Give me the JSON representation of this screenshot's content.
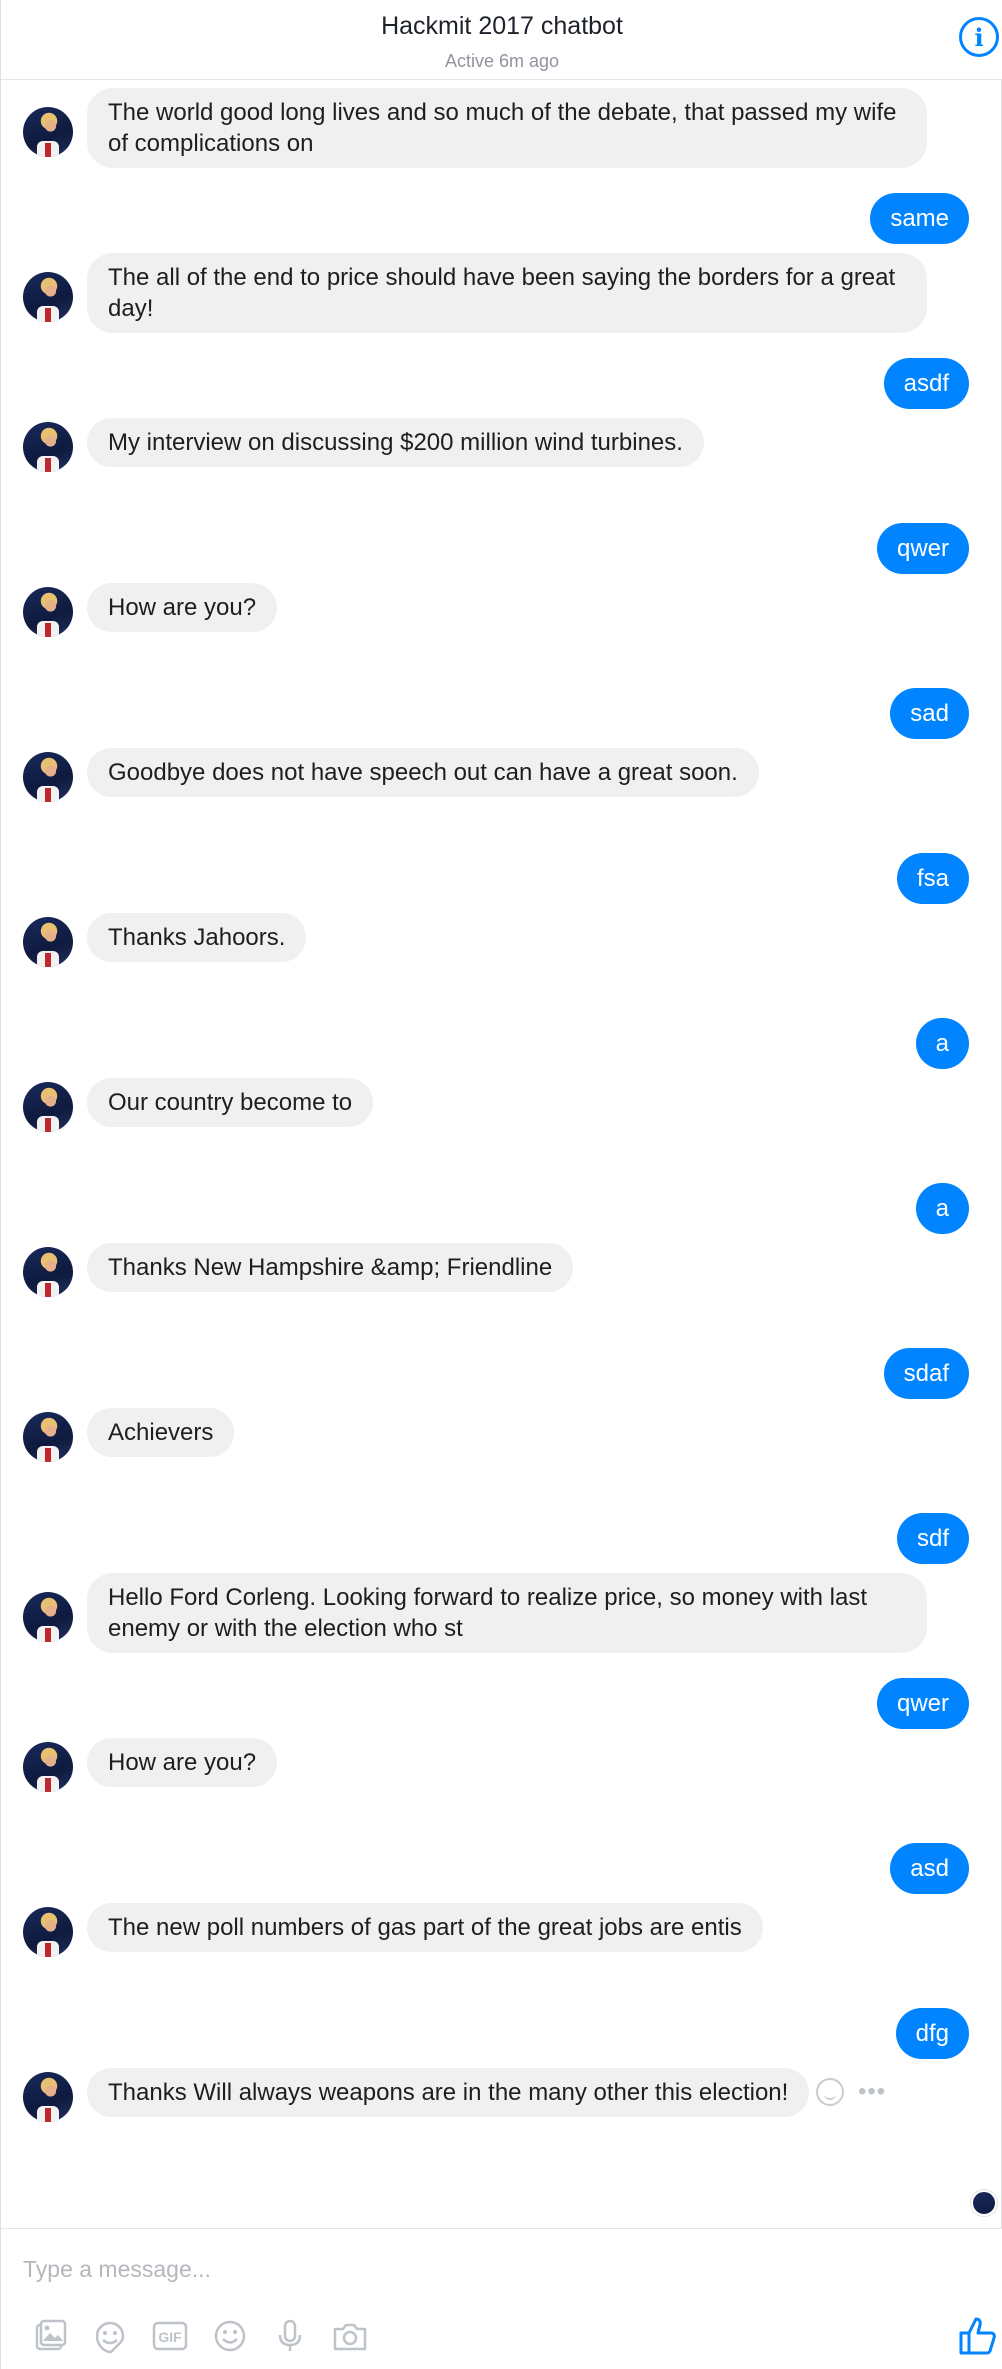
{
  "header": {
    "title": "Hackmit 2017 chatbot",
    "status": "Active 6m ago",
    "info_icon": "info-icon"
  },
  "messages": [
    {
      "from": "bot",
      "text": "The world good long lives and so much of the debate, that passed my wife of complications on"
    },
    {
      "from": "user",
      "text": "same"
    },
    {
      "from": "bot",
      "text": "The all of the end to price should have been saying the borders for a great day!"
    },
    {
      "from": "user",
      "text": "asdf"
    },
    {
      "from": "bot",
      "text": "My interview on discussing $200 million wind turbines."
    },
    {
      "from": "user",
      "text": "qwer"
    },
    {
      "from": "bot",
      "text": "How are you?"
    },
    {
      "from": "user",
      "text": "sad"
    },
    {
      "from": "bot",
      "text": "Goodbye does not have speech out can have a great soon."
    },
    {
      "from": "user",
      "text": "fsa"
    },
    {
      "from": "bot",
      "text": "Thanks Jahoors."
    },
    {
      "from": "user",
      "text": "a"
    },
    {
      "from": "bot",
      "text": "Our country become to"
    },
    {
      "from": "user",
      "text": "a"
    },
    {
      "from": "bot",
      "text": "Thanks New Hampshire &amp; Friendline"
    },
    {
      "from": "user",
      "text": "sdaf"
    },
    {
      "from": "bot",
      "text": "Achievers"
    },
    {
      "from": "user",
      "text": "sdf"
    },
    {
      "from": "bot",
      "text": "Hello Ford Corleng. Looking forward to realize price, so money with last enemy or with the election who st"
    },
    {
      "from": "user",
      "text": "qwer"
    },
    {
      "from": "bot",
      "text": "How are you?"
    },
    {
      "from": "user",
      "text": "asd"
    },
    {
      "from": "bot",
      "text": "The new poll numbers of gas part of the great jobs are entis"
    },
    {
      "from": "user",
      "text": "dfg"
    },
    {
      "from": "bot",
      "text": "Thanks Will always weapons are in the many other this election!"
    }
  ],
  "composer": {
    "placeholder": "Type a message...",
    "value": "",
    "tools": [
      "image-icon",
      "sticker-icon",
      "gif-icon",
      "emoji-icon",
      "microphone-icon",
      "camera-icon"
    ],
    "gif_label": "GIF",
    "like_icon": "thumbs-up-icon"
  },
  "colors": {
    "accent": "#0084ff",
    "incoming_bubble": "#f1f0f0",
    "outgoing_text": "#ffffff",
    "placeholder": "#b4b7bb",
    "tool_icon": "#bec3c9"
  }
}
